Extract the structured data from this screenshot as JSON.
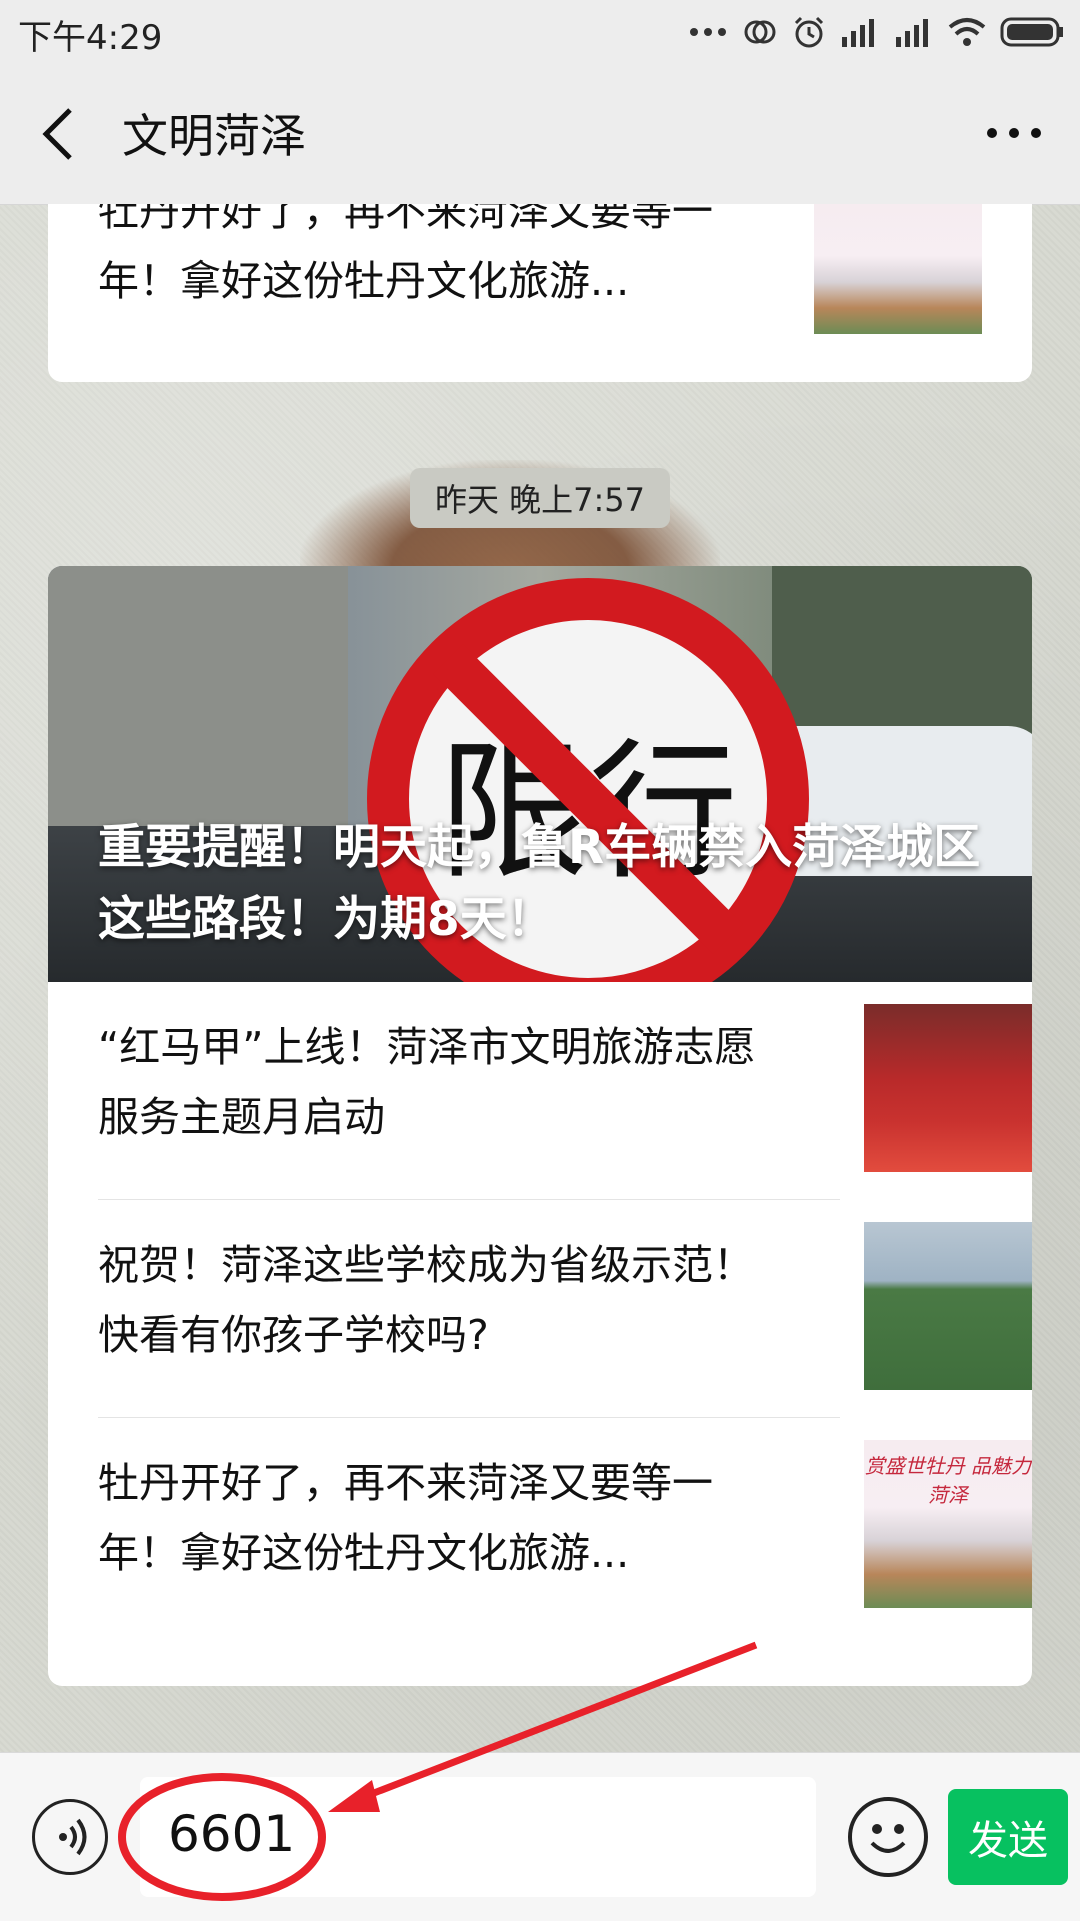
{
  "status_bar": {
    "time": "下午4:29"
  },
  "header": {
    "title": "文明菏泽"
  },
  "top_card": {
    "title": "牡丹开好了，再不来菏泽又要等一年！拿好这份牡丹文化旅游..."
  },
  "timestamp": "昨天 晚上7:57",
  "main_card": {
    "cover_title": "重要提醒！明天起，鲁R车辆禁入菏泽城区这些路段！为期8天！",
    "cover_sign_text": "限行",
    "articles": [
      {
        "title": "“红马甲”上线！菏泽市文明旅游志愿服务主题月启动"
      },
      {
        "title": "祝贺！菏泽这些学校成为省级示范！快看有你孩子学校吗?"
      },
      {
        "title": "牡丹开好了，再不来菏泽又要等一年！拿好这份牡丹文化旅游..."
      }
    ],
    "peony_thumb_label": "赏盛世牡丹 品魅力菏泽"
  },
  "input_bar": {
    "input_value": "6601",
    "send_label": "发送"
  },
  "colors": {
    "send_green": "#07c160",
    "annotation_red": "#e8212a"
  }
}
